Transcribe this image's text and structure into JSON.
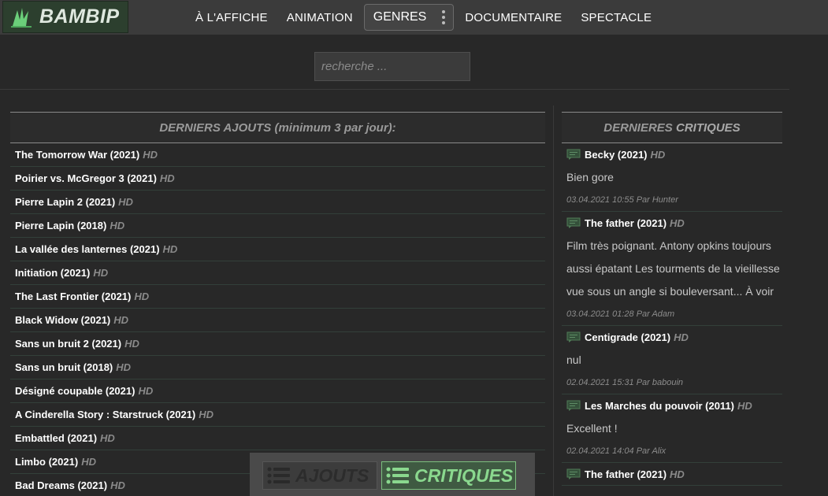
{
  "logo": {
    "text": "BAMBIP"
  },
  "nav": {
    "items": [
      "À L'AFFICHE",
      "ANIMATION",
      "GENRES",
      "DOCUMENTAIRE",
      "SPECTACLE"
    ]
  },
  "search": {
    "placeholder": "recherche ..."
  },
  "latest": {
    "title": "DERNIERS AJOUTS (minimum 3 par jour):",
    "items": [
      {
        "title": "The Tomorrow War (2021)",
        "badge": "HD"
      },
      {
        "title": "Poirier vs. McGregor 3 (2021)",
        "badge": "HD"
      },
      {
        "title": "Pierre Lapin 2 (2021)",
        "badge": "HD"
      },
      {
        "title": "Pierre Lapin (2018)",
        "badge": "HD"
      },
      {
        "title": "La vallée des lanternes (2021)",
        "badge": "HD"
      },
      {
        "title": "Initiation (2021)",
        "badge": "HD"
      },
      {
        "title": "The Last Frontier (2021)",
        "badge": "HD"
      },
      {
        "title": "Black Widow (2021)",
        "badge": "HD"
      },
      {
        "title": "Sans un bruit 2 (2021)",
        "badge": "HD"
      },
      {
        "title": "Sans un bruit (2018)",
        "badge": "HD"
      },
      {
        "title": "Désigné coupable (2021)",
        "badge": "HD"
      },
      {
        "title": "A Cinderella Story : Starstruck (2021)",
        "badge": "HD"
      },
      {
        "title": "Embattled (2021)",
        "badge": "HD"
      },
      {
        "title": "Limbo (2021)",
        "badge": "HD"
      },
      {
        "title": "Bad Dreams (2021)",
        "badge": "HD"
      }
    ]
  },
  "reviews": {
    "title_prefix": "DERNIERES ",
    "title_highlight": "CRITIQUES",
    "items": [
      {
        "title": "Becky (2021)",
        "badge": "HD",
        "text": "Bien gore",
        "meta": "03.04.2021 10:55 Par Hunter"
      },
      {
        "title": "The father (2021)",
        "badge": "HD",
        "text": "Film très poignant. Antony opkins toujours aussi épatant Les tourments de la vieillesse vue sous un angle si bouleversant... À voir",
        "meta": "03.04.2021 01:28 Par Adam"
      },
      {
        "title": "Centigrade (2021)",
        "badge": "HD",
        "text": "nul",
        "meta": "02.04.2021 15:31 Par babouin"
      },
      {
        "title": "Les Marches du pouvoir (2011)",
        "badge": "HD",
        "text": "Excellent !",
        "meta": "02.04.2021 14:04 Par Alix"
      },
      {
        "title": "The father (2021)",
        "badge": "HD",
        "text": "",
        "meta": ""
      }
    ]
  },
  "toggle": {
    "ajouts_label": "AJOUTS",
    "critiques_label": "CRITIQUES"
  },
  "colors": {
    "accent": "#8ad88e",
    "background": "#282828",
    "topbar": "#3b3b3b"
  }
}
